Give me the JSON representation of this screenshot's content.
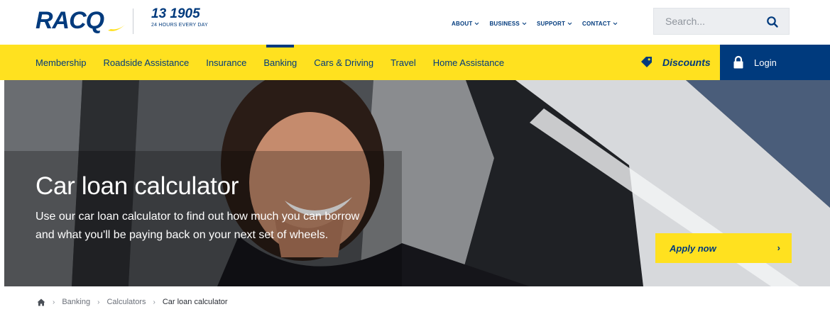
{
  "header": {
    "logo_text": "RACQ",
    "phone_number": "13 1905",
    "phone_sub": "24 HOURS EVERY DAY",
    "utility_nav": [
      {
        "label": "ABOUT"
      },
      {
        "label": "BUSINESS"
      },
      {
        "label": "SUPPORT"
      },
      {
        "label": "CONTACT"
      }
    ],
    "search": {
      "placeholder": "Search..."
    }
  },
  "main_nav": {
    "items": [
      {
        "label": "Membership",
        "active": false
      },
      {
        "label": "Roadside Assistance",
        "active": false
      },
      {
        "label": "Insurance",
        "active": false
      },
      {
        "label": "Banking",
        "active": true
      },
      {
        "label": "Cars & Driving",
        "active": false
      },
      {
        "label": "Travel",
        "active": false
      },
      {
        "label": "Home Assistance",
        "active": false
      }
    ],
    "discounts_label": "Discounts",
    "login_label": "Login"
  },
  "hero": {
    "title": "Car loan calculator",
    "description": "Use our car loan calculator to find out how much you can borrow and what you'll be paying back on your next set of wheels.",
    "cta_label": "Apply now",
    "cta_chevron": "›"
  },
  "breadcrumb": {
    "separator": "›",
    "items": [
      "Banking",
      "Calculators",
      "Car loan calculator"
    ]
  },
  "colors": {
    "brand_blue": "#003a7d",
    "brand_yellow": "#ffe11f"
  },
  "icons": [
    "search-icon",
    "tag-icon",
    "lock-icon",
    "home-icon",
    "chevron-down-icon",
    "chevron-right-icon"
  ]
}
